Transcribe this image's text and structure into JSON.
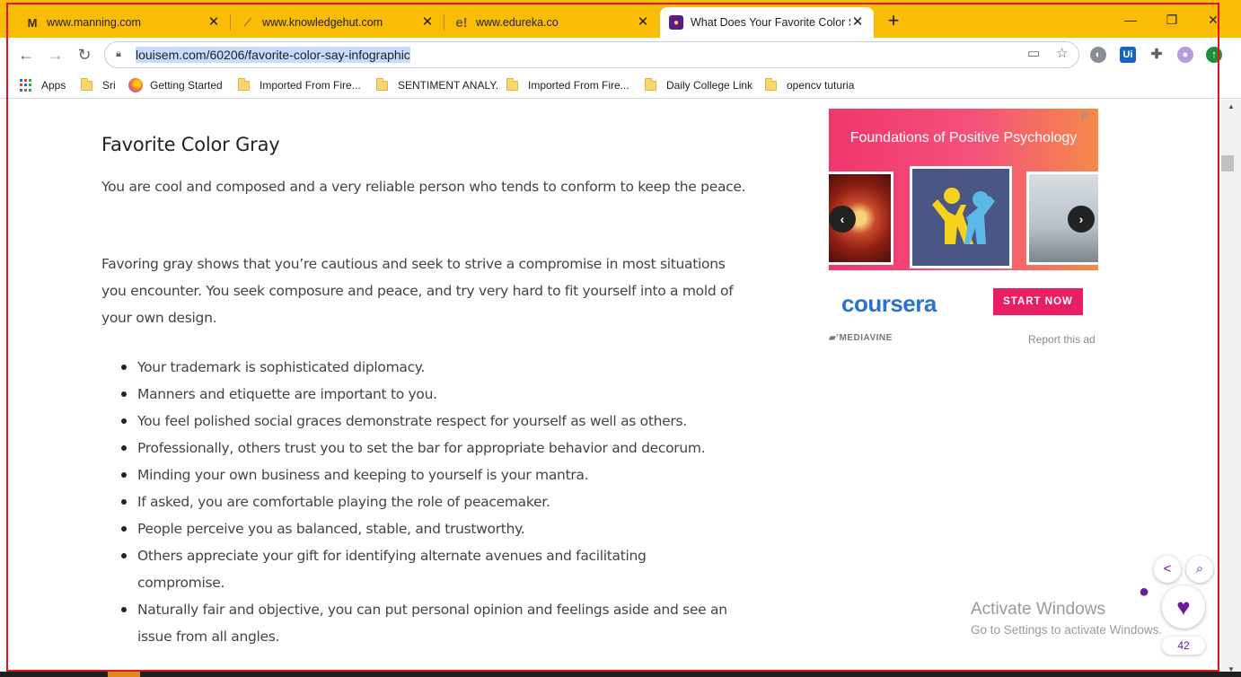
{
  "tabs": [
    {
      "title": "www.manning.com",
      "icon": "manning-icon",
      "active": false
    },
    {
      "title": "www.knowledgehut.com",
      "icon": "knowledgehut-icon",
      "active": false
    },
    {
      "title": "www.edureka.co",
      "icon": "edureka-icon",
      "active": false
    },
    {
      "title": "What Does Your Favorite Color Say",
      "icon": "louisem-icon",
      "active": true
    }
  ],
  "window_controls": {
    "minimize": "—",
    "maximize": "❐",
    "close": "✕"
  },
  "address_bar": {
    "url": "louisem.com/60206/favorite-color-say-infographic"
  },
  "bookmarks": [
    {
      "label": "Apps",
      "icon": "apps-grid-icon"
    },
    {
      "label": "Sri",
      "icon": "folder-icon"
    },
    {
      "label": "Getting Started",
      "icon": "firefox-icon"
    },
    {
      "label": "Imported From Fire...",
      "icon": "folder-icon"
    },
    {
      "label": "SENTIMENT ANALY.",
      "icon": "folder-icon"
    },
    {
      "label": "Imported From Fire...",
      "icon": "folder-icon"
    },
    {
      "label": "Daily College Link",
      "icon": "folder-icon"
    },
    {
      "label": "opencv tuturia",
      "icon": "folder-icon"
    }
  ],
  "article": {
    "heading": "Favorite Color Gray",
    "paragraphs": [
      "You are cool and composed and a very reliable person who tends to conform to keep the peace.",
      "Favoring gray shows that you’re cautious and seek to strive a compromise in most situations you encounter. You seek composure and peace, and try very hard to fit yourself into a mold of your own design."
    ],
    "bullets": [
      "Your trademark is sophisticated diplomacy.",
      "Manners and etiquette are important to you.",
      "You feel polished social graces demonstrate respect for yourself as well as others.",
      "Professionally, others trust you to set the bar for appropriate behavior and decorum.",
      "Minding your own business and keeping to yourself is your mantra.",
      "If asked, you are comfortable playing the role of peacemaker.",
      "People perceive you as balanced, stable, and trustworthy.",
      "Others appreciate your gift for identifying alternate avenues and facilitating compromise.",
      "Naturally fair and objective, you can put personal opinion and feelings aside and see an issue from all angles."
    ]
  },
  "ad": {
    "title": "Foundations of Positive Psychology",
    "brand": "coursera",
    "cta": "START NOW",
    "network": "MEDIAVINE",
    "report": "Report this ad"
  },
  "floating": {
    "like_count": "42"
  },
  "watermark": {
    "line1": "Activate Windows",
    "line2": "Go to Settings to activate Windows."
  },
  "colors": {
    "tabstrip": "#fbbc05",
    "accent_purple": "#6a1b9a",
    "coursera_blue": "#2a73cc",
    "cta_pink": "#e91e63",
    "frame_red": "#e0141e"
  }
}
